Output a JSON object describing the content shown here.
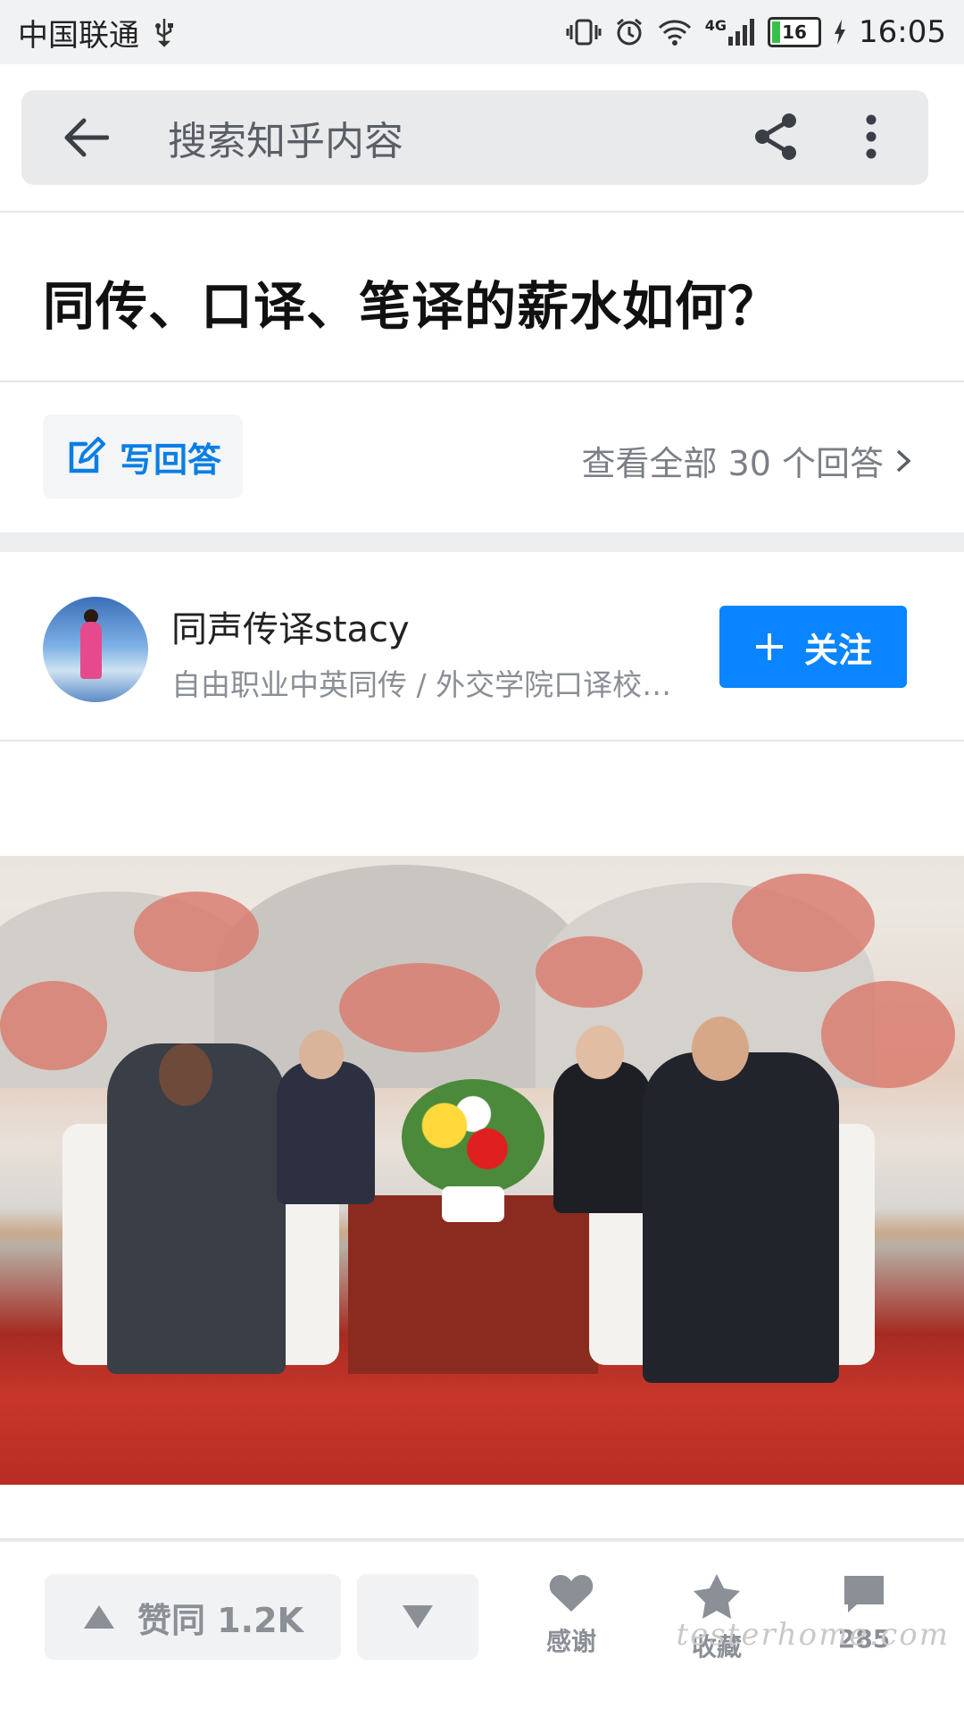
{
  "status_bar": {
    "carrier": "中国联通",
    "network": "4G",
    "battery": "16",
    "time": "16:05"
  },
  "search": {
    "placeholder": "搜索知乎内容"
  },
  "question": {
    "title": "同传、口译、笔译的薪水如何？"
  },
  "actions": {
    "write_answer": "写回答",
    "view_all": "查看全部 30 个回答"
  },
  "author": {
    "name": "同声传译stacy",
    "bio": "自由职业中英同传 / 外交学院口译校…",
    "follow_label": "关注"
  },
  "bottom_bar": {
    "upvote_label": "赞同 1.2K",
    "thanks_label": "感谢",
    "collect_label": "收藏",
    "comment_count": "285"
  },
  "watermark": "testerhome.com",
  "colors": {
    "accent": "#0a84ff",
    "write_answer_text": "#0a7ee5",
    "status_bar_bg": "#f1f2f4"
  },
  "icons": [
    "usb-icon",
    "vibrate-icon",
    "alarm-icon",
    "wifi-icon",
    "signal-icon",
    "battery-icon",
    "back-arrow-icon",
    "share-icon",
    "more-vertical-icon",
    "edit-icon",
    "chevron-right-icon",
    "plus-icon",
    "triangle-up-icon",
    "triangle-down-icon",
    "heart-icon",
    "star-icon",
    "comment-icon"
  ]
}
